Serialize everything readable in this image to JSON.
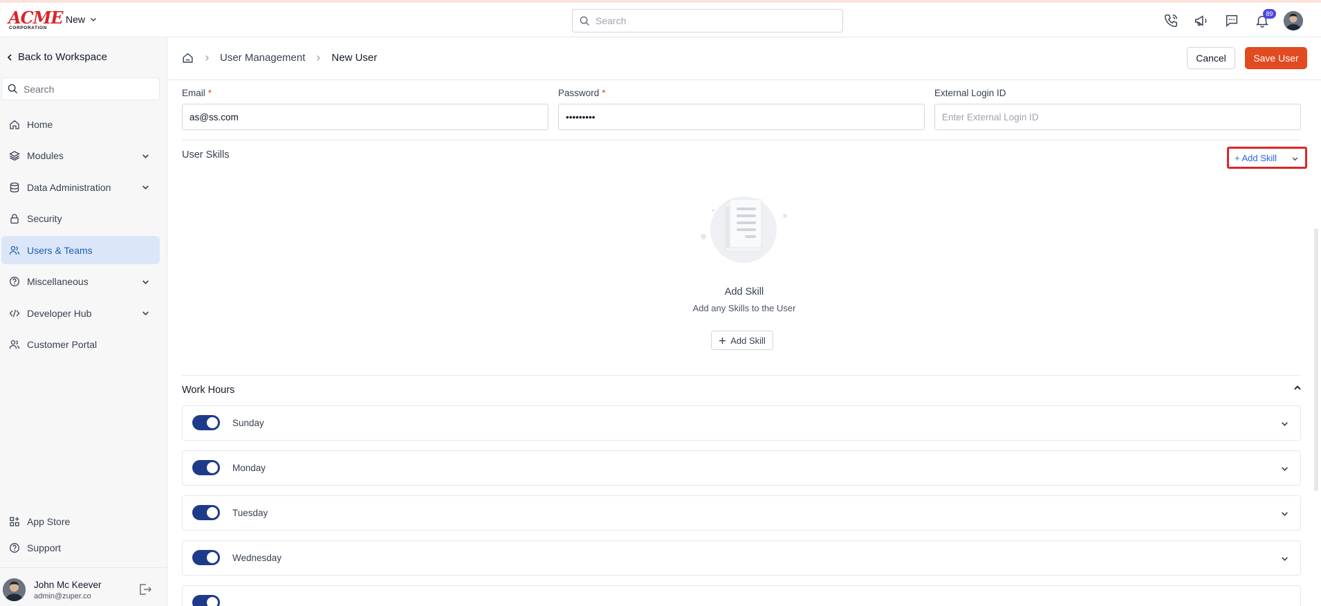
{
  "topbar": {
    "logo_main": "ACME",
    "logo_sub": "CORPORATION",
    "new_label": "New",
    "search_placeholder": "Search",
    "notification_count": "89"
  },
  "sidebar": {
    "back_label": "Back to Workspace",
    "search_placeholder": "Search",
    "items": [
      {
        "label": "Home",
        "icon": "home-icon",
        "expandable": false
      },
      {
        "label": "Modules",
        "icon": "layers-icon",
        "expandable": true
      },
      {
        "label": "Data Administration",
        "icon": "database-icon",
        "expandable": true
      },
      {
        "label": "Security",
        "icon": "lock-icon",
        "expandable": false
      },
      {
        "label": "Users & Teams",
        "icon": "users-icon",
        "expandable": false,
        "active": true
      },
      {
        "label": "Miscellaneous",
        "icon": "help-circle-icon",
        "expandable": true
      },
      {
        "label": "Developer Hub",
        "icon": "code-icon",
        "expandable": true
      },
      {
        "label": "Customer Portal",
        "icon": "users-icon",
        "expandable": false
      }
    ],
    "bottom_items": [
      {
        "label": "App Store",
        "icon": "app-grid-icon"
      },
      {
        "label": "Support",
        "icon": "help-circle-icon"
      }
    ],
    "user": {
      "name": "John Mc Keever",
      "email": "admin@zuper.co"
    }
  },
  "header": {
    "breadcrumb_parent": "User Management",
    "breadcrumb_current": "New User",
    "cancel_label": "Cancel",
    "save_label": "Save User"
  },
  "form": {
    "email": {
      "label": "Email",
      "value": "as@ss.com"
    },
    "password": {
      "label": "Password",
      "value": "•••••••••"
    },
    "external_login": {
      "label": "External Login ID",
      "placeholder": "Enter External Login ID"
    }
  },
  "skills": {
    "title": "User Skills",
    "add_button": "+ Add Skill",
    "empty_title": "Add Skill",
    "empty_subtitle": "Add any Skills to the User",
    "empty_button": "Add Skill"
  },
  "work_hours": {
    "title": "Work Hours",
    "days": [
      {
        "name": "Sunday",
        "enabled": true
      },
      {
        "name": "Monday",
        "enabled": true
      },
      {
        "name": "Tuesday",
        "enabled": true
      },
      {
        "name": "Wednesday",
        "enabled": true
      }
    ]
  },
  "colors": {
    "accent": "#e24a1f",
    "active_bg": "#dbe7f8",
    "toggle_on": "#1e3a8a",
    "highlight": "#dc2626"
  }
}
